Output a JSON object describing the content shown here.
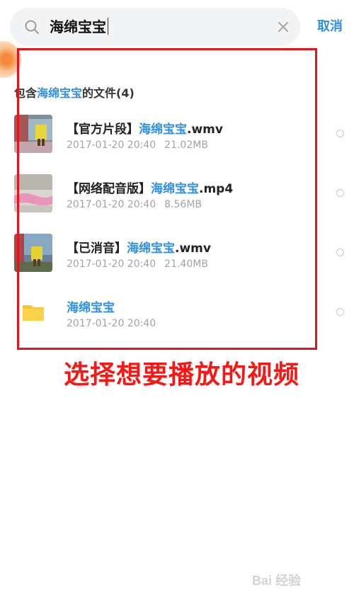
{
  "search": {
    "query": "海绵宝宝",
    "cancel_label": "取消"
  },
  "results": {
    "header_prefix": "包含",
    "header_keyword": "海绵宝宝",
    "header_suffix": "的文件(4)",
    "items": [
      {
        "title_prefix": "【官方片段】",
        "title_keyword": "海绵宝宝",
        "title_suffix": ".wmv",
        "date": "2017-01-20 20:40",
        "size": "21.02MB",
        "type": "video"
      },
      {
        "title_prefix": "【网络配音版】",
        "title_keyword": "海绵宝宝",
        "title_suffix": ".mp4",
        "date": "2017-01-20 20:40",
        "size": "8.56MB",
        "type": "video"
      },
      {
        "title_prefix": "【已消音】",
        "title_keyword": "海绵宝宝",
        "title_suffix": ".wmv",
        "date": "2017-01-20 20:40",
        "size": "21.40MB",
        "type": "video"
      },
      {
        "title_prefix": "",
        "title_keyword": "海绵宝宝",
        "title_suffix": "",
        "date": "2017-01-20 20:40",
        "size": "",
        "type": "folder"
      }
    ]
  },
  "annotation": {
    "caption": "选择想要播放的视频"
  },
  "watermark": {
    "text": "Bai 经验"
  },
  "colors": {
    "accent": "#2f8fe3",
    "highlight_border": "#e3141c",
    "caption": "#ff1414",
    "folder": "#f7c531"
  }
}
